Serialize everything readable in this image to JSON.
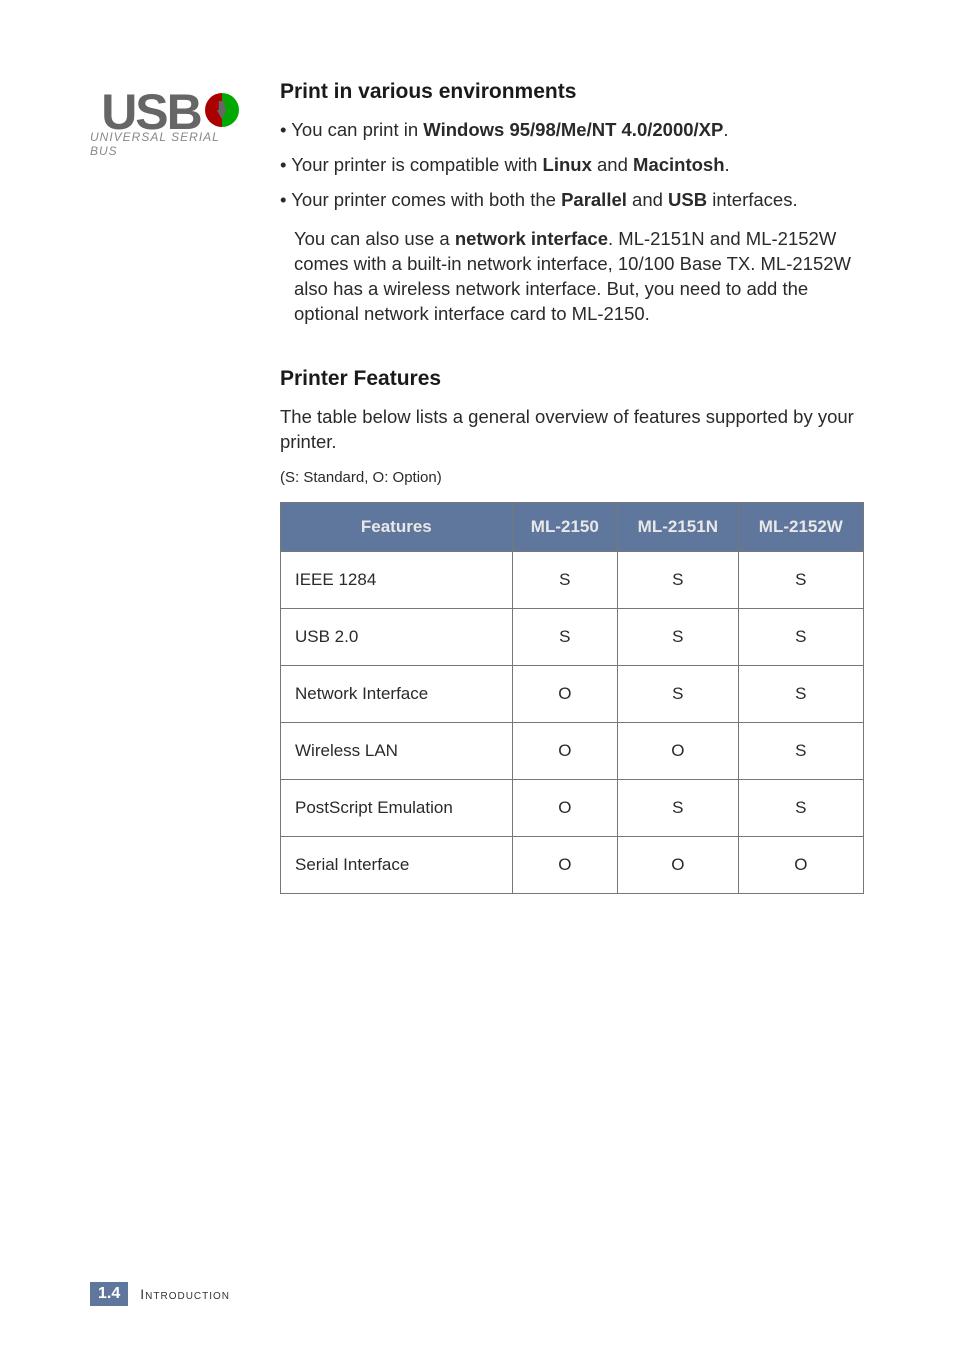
{
  "logo": {
    "text": "USB",
    "subtitle": "UNIVERSAL SERIAL BUS"
  },
  "section1": {
    "heading": "Print in various environments",
    "bullets": [
      {
        "pre": "• You can print in ",
        "bold1": "Windows 95/98/Me/NT 4.0/2000/XP",
        "post": "."
      },
      {
        "pre": "• Your printer is compatible with ",
        "bold1": "Linux",
        "mid": " and ",
        "bold2": "Macintosh",
        "post": "."
      },
      {
        "pre": "• Your printer comes with both the ",
        "bold1": "Parallel",
        "mid": " and ",
        "bold2": "USB",
        "post": " interfaces."
      }
    ],
    "para_pre": "You can also use a ",
    "para_bold": "network interface",
    "para_post": ". ML-2151N and ML-2152W comes with a built-in network interface, 10/100 Base TX. ML-2152W also has a wireless network interface. But, you need to add the optional network interface card to ML-2150."
  },
  "section2": {
    "heading": "Printer Features",
    "intro": "The table below lists a general overview of features supported by your printer.",
    "legend": "(S: Standard, O: Option)"
  },
  "chart_data": {
    "type": "table",
    "headers": [
      "Features",
      "ML-2150",
      "ML-2151N",
      "ML-2152W"
    ],
    "rows": [
      [
        "IEEE 1284",
        "S",
        "S",
        "S"
      ],
      [
        "USB 2.0",
        "S",
        "S",
        "S"
      ],
      [
        "Network Interface",
        "O",
        "S",
        "S"
      ],
      [
        "Wireless LAN",
        "O",
        "O",
        "S"
      ],
      [
        "PostScript Emulation",
        "O",
        "S",
        "S"
      ],
      [
        "Serial Interface",
        "O",
        "O",
        "O"
      ]
    ]
  },
  "footer": {
    "page_chapter": "1.",
    "page_num": "4",
    "label": "Introduction"
  }
}
